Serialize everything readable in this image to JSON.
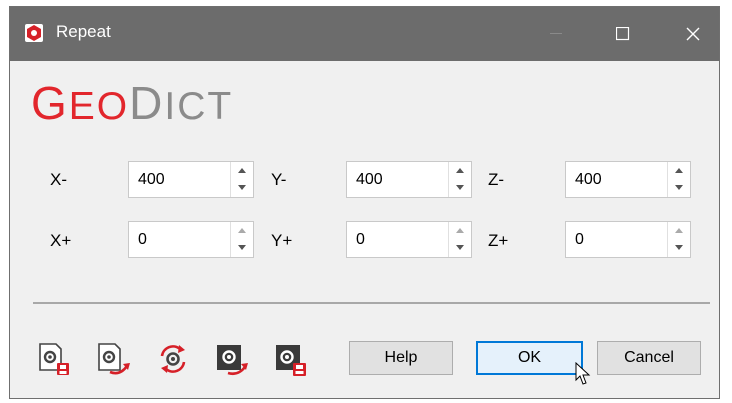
{
  "window": {
    "title": "Repeat"
  },
  "logo": {
    "part1": "Geo",
    "part2": "Dict"
  },
  "fields": [
    {
      "label": "X-",
      "value": "400"
    },
    {
      "label": "Y-",
      "value": "400"
    },
    {
      "label": "Z-",
      "value": "400"
    },
    {
      "label": "X+",
      "value": "0"
    },
    {
      "label": "Y+",
      "value": "0"
    },
    {
      "label": "Z+",
      "value": "0"
    }
  ],
  "toolbar": {
    "icons": [
      "load-settings-icon",
      "save-settings-icon",
      "reset-settings-icon",
      "export-settings-icon",
      "import-settings-icon"
    ]
  },
  "buttons": {
    "help": "Help",
    "ok": "OK",
    "cancel": "Cancel"
  },
  "colors": {
    "brand_red": "#e2262c",
    "logo_gray": "#8b8b8b",
    "titlebar": "#6c6c6c",
    "focus_blue": "#0078d7"
  }
}
